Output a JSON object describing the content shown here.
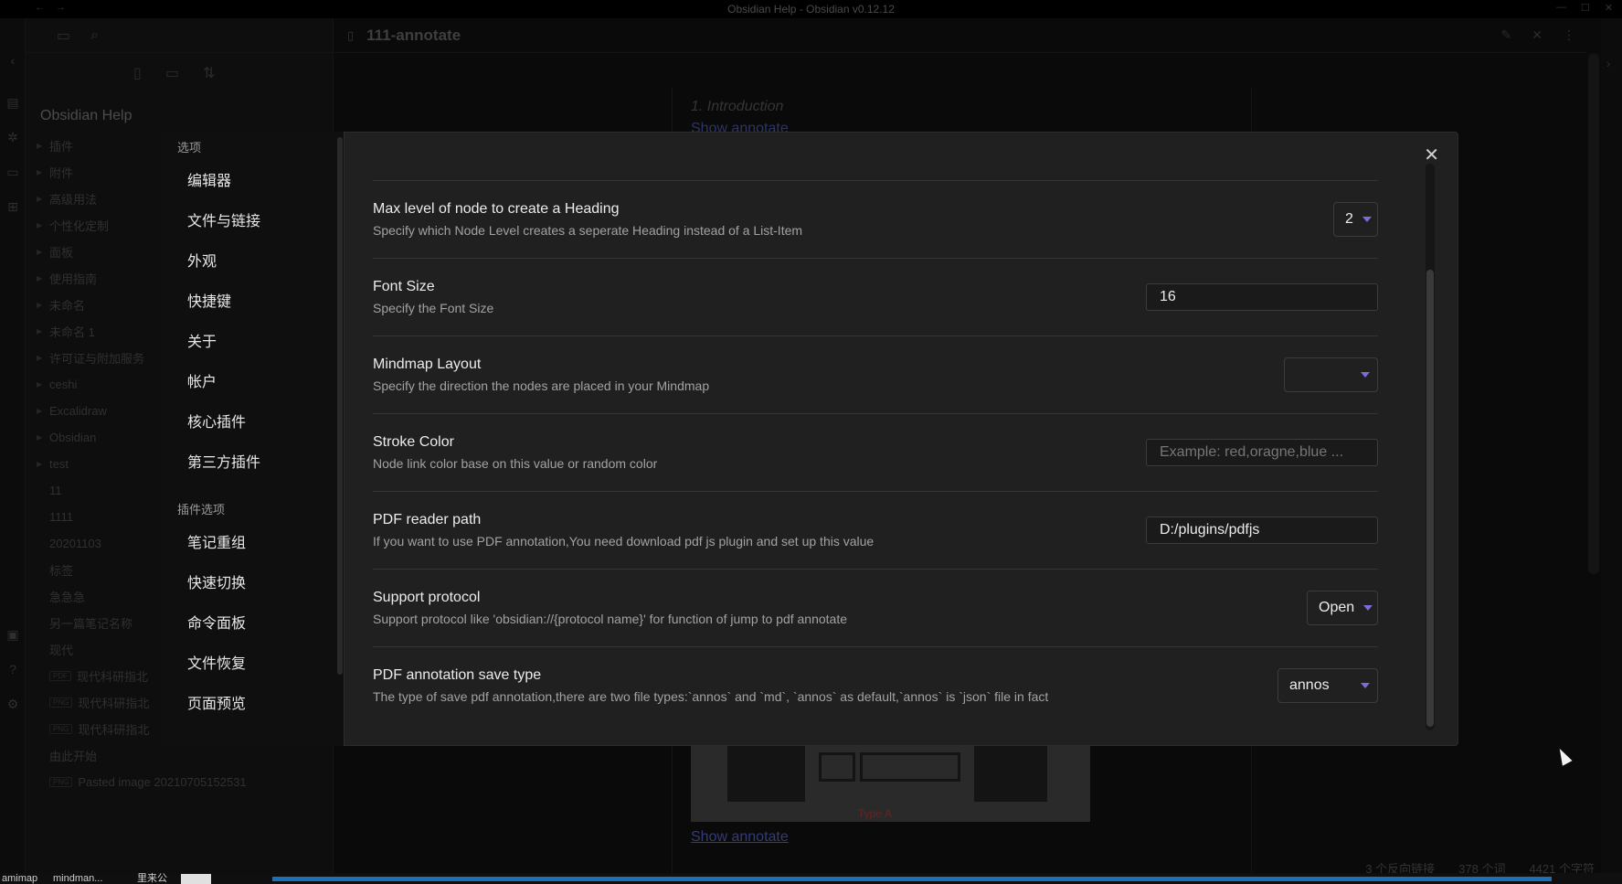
{
  "window": {
    "title": "Obsidian Help - Obsidian v0.12.12"
  },
  "editor": {
    "doc_title": "111-annotate",
    "intro": "1. Introduction",
    "show_annotate_top": "Show annotate",
    "image_caption": "Type A",
    "show_annotate": "Show annotate"
  },
  "explorer": {
    "vault_name": "Obsidian Help",
    "folders": [
      "插件",
      "附件",
      "高级用法",
      "个性化定制",
      "面板",
      "使用指南",
      "未命名",
      "未命名 1",
      "许可证与附加服务",
      "ceshi",
      "Excalidraw",
      "Obsidian",
      "test"
    ],
    "files": [
      "11",
      "1111",
      "20201103",
      "标签",
      "急急急",
      "另一篇笔记名称",
      "现代"
    ],
    "attachments": [
      {
        "ext": "PDF",
        "name": "现代科研指北"
      },
      {
        "ext": "PNG",
        "name": "现代科研指北"
      },
      {
        "ext": "PNG",
        "name": "现代科研指北"
      }
    ],
    "start_file": "由此开始",
    "pasted": {
      "ext": "PNG",
      "name": "Pasted image 20210705152531"
    }
  },
  "settings_nav": {
    "group_options": "选项",
    "options": [
      "编辑器",
      "文件与链接",
      "外观",
      "快捷键",
      "关于",
      "帐户",
      "核心插件",
      "第三方插件"
    ],
    "group_plugins": "插件选项",
    "plugins": [
      "笔记重组",
      "快速切换",
      "命令面板",
      "文件恢复",
      "页面预览"
    ]
  },
  "settings": {
    "max_heading": {
      "name": "Max level of node to create a Heading",
      "desc": "Specify which Node Level creates a seperate Heading instead of a List-Item",
      "value": "2"
    },
    "font_size": {
      "name": "Font Size",
      "desc": "Specify the Font Size",
      "value": "16"
    },
    "layout": {
      "name": "Mindmap Layout",
      "desc": "Specify the direction the nodes are placed in your Mindmap",
      "value": ""
    },
    "stroke": {
      "name": "Stroke Color",
      "desc": "Node link color base on this value or random color",
      "placeholder": "Example: red,oragne,blue ..."
    },
    "pdf_path": {
      "name": "PDF reader path",
      "desc": "If you want to use PDF annotation,You need download pdf js plugin and set up this value",
      "value": "D:/plugins/pdfjs"
    },
    "protocol": {
      "name": "Support protocol",
      "desc": "Support protocol like 'obsidian://{protocol name}' for function of jump to pdf annotate",
      "value": "Open"
    },
    "save_type": {
      "name": "PDF annotation save type",
      "desc": "The type of save pdf annotation,there are two file types:`annos` and `md`,  `annos` as default,`annos` is `json` file in fact",
      "value": "annos"
    }
  },
  "status": {
    "backlinks": "3 个反向链接",
    "words": "378 个词",
    "chars": "4421 个字符"
  },
  "taskbar": {
    "item1": "amimap",
    "item2": "mindman...",
    "item3": "里来公"
  },
  "colors": {
    "accent": "#7b6cd9",
    "modal_bg": "#202020",
    "link": "#333c76"
  }
}
